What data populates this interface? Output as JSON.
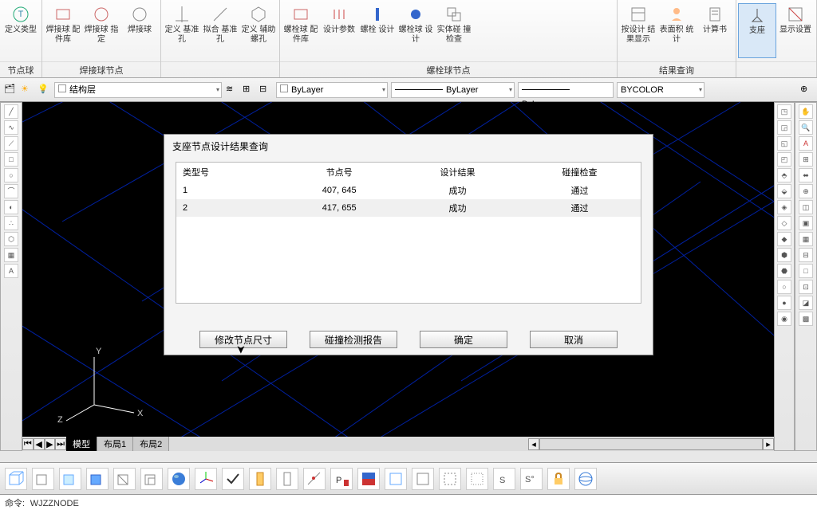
{
  "ribbon": {
    "groups": [
      {
        "label": "节点球",
        "items": [
          {
            "label": "定义类型"
          }
        ]
      },
      {
        "label": "焊接球节点",
        "items": [
          {
            "label": "焊接球\n配件库"
          },
          {
            "label": "焊接球\n指定"
          },
          {
            "label": "焊接球"
          }
        ]
      },
      {
        "label": "",
        "items": [
          {
            "label": "定义\n基准孔"
          },
          {
            "label": "拟合\n基准孔"
          },
          {
            "label": "定义\n辅助螺孔"
          }
        ]
      },
      {
        "label": "螺栓球节点",
        "items": [
          {
            "label": "螺栓球\n配件库"
          },
          {
            "label": "设计参数"
          },
          {
            "label": "螺栓\n设计"
          },
          {
            "label": "螺栓球\n设计"
          },
          {
            "label": "实体碰\n撞检查"
          }
        ]
      },
      {
        "label": "结果查询",
        "items": [
          {
            "label": "按设计\n结果显示"
          },
          {
            "label": "表面积\n统计"
          },
          {
            "label": "计算书"
          }
        ]
      },
      {
        "label": "",
        "items": [
          {
            "label": "支座",
            "sel": true
          },
          {
            "label": "显示设置"
          }
        ]
      }
    ]
  },
  "propsbar": {
    "layer": "结构层",
    "linetype1": "ByLayer",
    "linetype2": "ByLayer",
    "lineweight": "ByLayer",
    "color": "BYCOLOR"
  },
  "dialog": {
    "title": "支座节点设计结果查询",
    "cols": [
      "类型号",
      "节点号",
      "设计结果",
      "碰撞检查"
    ],
    "rows": [
      {
        "c0": "1",
        "c1": "407, 645",
        "c2": "成功",
        "c3": "通过"
      },
      {
        "c0": "2",
        "c1": "417, 655",
        "c2": "成功",
        "c3": "通过"
      }
    ],
    "btns": {
      "modify": "修改节点尺寸",
      "report": "碰撞检测报告",
      "ok": "确定",
      "cancel": "取消"
    }
  },
  "canvas": {
    "axes": {
      "x": "X",
      "y": "Y",
      "z": "Z"
    }
  },
  "tabs": {
    "t0": "模型",
    "t1": "布局1",
    "t2": "布局2"
  },
  "cmd": {
    "prompt": "命令:",
    "text": "WJZZNODE"
  }
}
